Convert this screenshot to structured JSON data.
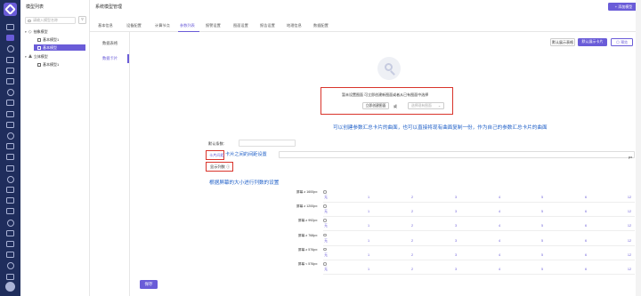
{
  "sidebar": {
    "icons": [
      "home-icon",
      "cube-icon",
      "layers-icon",
      "cloud-icon",
      "chart-icon",
      "settings-icon",
      "doc-icon",
      "globe-icon",
      "list-icon",
      "grid-icon",
      "user-icon",
      "box-icon",
      "table-icon",
      "shield-icon",
      "folder-icon",
      "monitor-icon",
      "tag-icon",
      "flag-icon",
      "bell-icon",
      "database-icon",
      "message-icon",
      "calendar-icon",
      "help-icon",
      "plug-icon"
    ]
  },
  "tree": {
    "title": "模型列表",
    "search_placeholder": "请输入模型名称",
    "filter_icon": "filter-icon",
    "nodes": [
      {
        "label": "抽象模型",
        "level": 0,
        "icon": "diamond"
      },
      {
        "label": "基本模型1",
        "level": 1,
        "icon": "square"
      },
      {
        "label": "基本模型",
        "level": 1,
        "icon": "square",
        "selected": true
      },
      {
        "label": "立体模型",
        "level": 0,
        "icon": "triangle"
      },
      {
        "label": "基本模型1",
        "level": 1,
        "icon": "square"
      }
    ]
  },
  "header": {
    "title": "系统模型管理",
    "add_button": "+ 添加模型"
  },
  "tabs": [
    "基本信息",
    "设备配置",
    "计算节点",
    "参数列表",
    "报警设置",
    "图面设置",
    "报告设置",
    "地理信息",
    "数据配置"
  ],
  "active_tab": "参数列表",
  "subnav": [
    "数据表格",
    "数据卡片"
  ],
  "active_subnav": "数据卡片",
  "toolbar": {
    "btn1": "默认展示表格",
    "btn2": "默认展示卡片",
    "btn3": "预览"
  },
  "empty": {
    "text": "暂未设置图面 可立即创建新图面或者从已有图面中选择",
    "create_btn": "立即创建图面",
    "or": "或",
    "select_placeholder": "选择现有图面"
  },
  "annotations": {
    "a1": "可以创建参数汇总卡片的曲面，也可以直接将现有曲面复制一份，作为自己的参数汇总卡片的曲面",
    "a2": "卡片之间的间距设置",
    "a3": "根据屏幕的大小进行列数的设置"
  },
  "form": {
    "default_name_label": "默认条数:",
    "card_gap_label": "卡片间距",
    "card_gap_unit": "px",
    "columns_label": "显示列数",
    "columns_info": "ⓘ"
  },
  "breakpoints": [
    {
      "label": "屏幕 ≥ 1600px:",
      "first": "无",
      "values": [
        "1",
        "2",
        "3",
        "4",
        "5",
        "6",
        "12"
      ]
    },
    {
      "label": "屏幕 ≥ 1200px:",
      "first": "无",
      "values": [
        "1",
        "2",
        "3",
        "4",
        "5",
        "6",
        "12"
      ]
    },
    {
      "label": "屏幕 ≥ 992px:",
      "first": "无",
      "values": [
        "1",
        "2",
        "3",
        "4",
        "5",
        "6",
        "12"
      ]
    },
    {
      "label": "屏幕 ≥ 768px:",
      "first": "无",
      "values": [
        "1",
        "2",
        "3",
        "4",
        "5",
        "6",
        "12"
      ]
    },
    {
      "label": "屏幕 ≥ 576px:",
      "first": "无",
      "values": [
        "1",
        "2",
        "3",
        "4",
        "5",
        "6",
        "12"
      ]
    },
    {
      "label": "屏幕 < 576px:",
      "first": "无",
      "values": [
        "1",
        "2",
        "3",
        "4",
        "5",
        "6",
        "12"
      ]
    }
  ],
  "save_button": "保存",
  "colors": {
    "accent": "#6a5cd8",
    "sidebar": "#1f2d5c",
    "annotation": "#2060c8",
    "highlight": "#d9342b"
  }
}
